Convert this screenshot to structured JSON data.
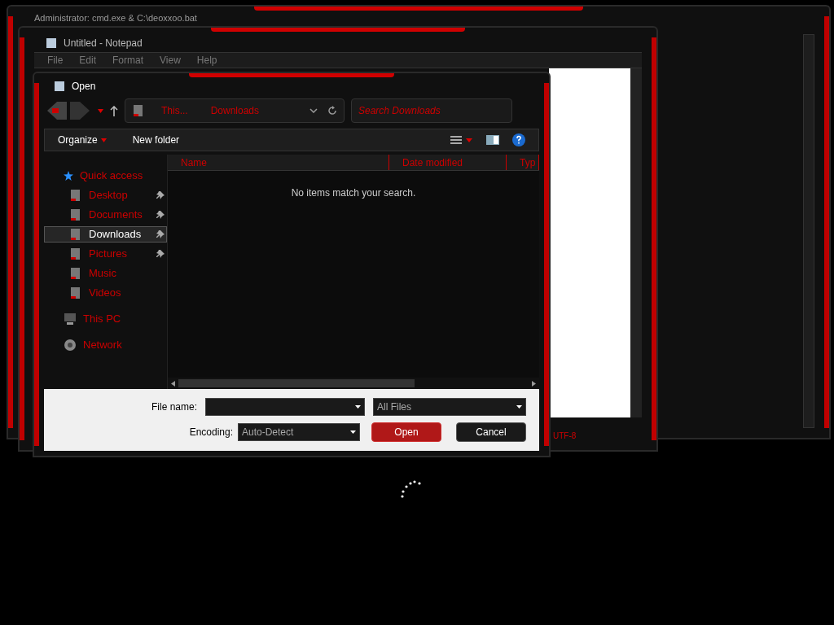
{
  "cmd_window": {
    "title": "Administrator: cmd.exe & C:\\deoxxoo.bat"
  },
  "notepad": {
    "title": "Untitled - Notepad",
    "menu": [
      "File",
      "Edit",
      "Format",
      "View",
      "Help"
    ],
    "status_encoding": "UTF-8"
  },
  "open_dialog": {
    "title": "Open",
    "breadcrumb": [
      "This...",
      "Downloads"
    ],
    "search": {
      "placeholder": "Search Downloads"
    },
    "toolbar": [
      {
        "label": "Organize",
        "dropdown": true
      },
      {
        "label": "New folder",
        "dropdown": false
      }
    ],
    "nav": [
      {
        "label": "Quick access",
        "kind": "star",
        "selected": false,
        "children": [
          {
            "label": "Desktop",
            "kind": "folder",
            "pinned": true,
            "selected": false
          },
          {
            "label": "Documents",
            "kind": "folder",
            "pinned": true,
            "selected": false
          },
          {
            "label": "Downloads",
            "kind": "folder",
            "pinned": true,
            "selected": true
          },
          {
            "label": "Pictures",
            "kind": "folder",
            "pinned": true,
            "selected": false
          },
          {
            "label": "Music",
            "kind": "folder",
            "pinned": false,
            "selected": false
          },
          {
            "label": "Videos",
            "kind": "folder",
            "pinned": false,
            "selected": false
          }
        ]
      },
      {
        "label": "This PC",
        "kind": "pc",
        "selected": false
      },
      {
        "label": "Network",
        "kind": "network",
        "selected": false
      }
    ],
    "columns": [
      "Name",
      "Date modified",
      "Typ"
    ],
    "empty_message": "No items match your search.",
    "file_name_label": "File name:",
    "file_type": "All Files",
    "encoding_label": "Encoding:",
    "encoding": "Auto-Detect",
    "buttons": [
      {
        "label": "Open",
        "kind": "primary"
      },
      {
        "label": "Cancel",
        "kind": "secondary"
      }
    ]
  }
}
